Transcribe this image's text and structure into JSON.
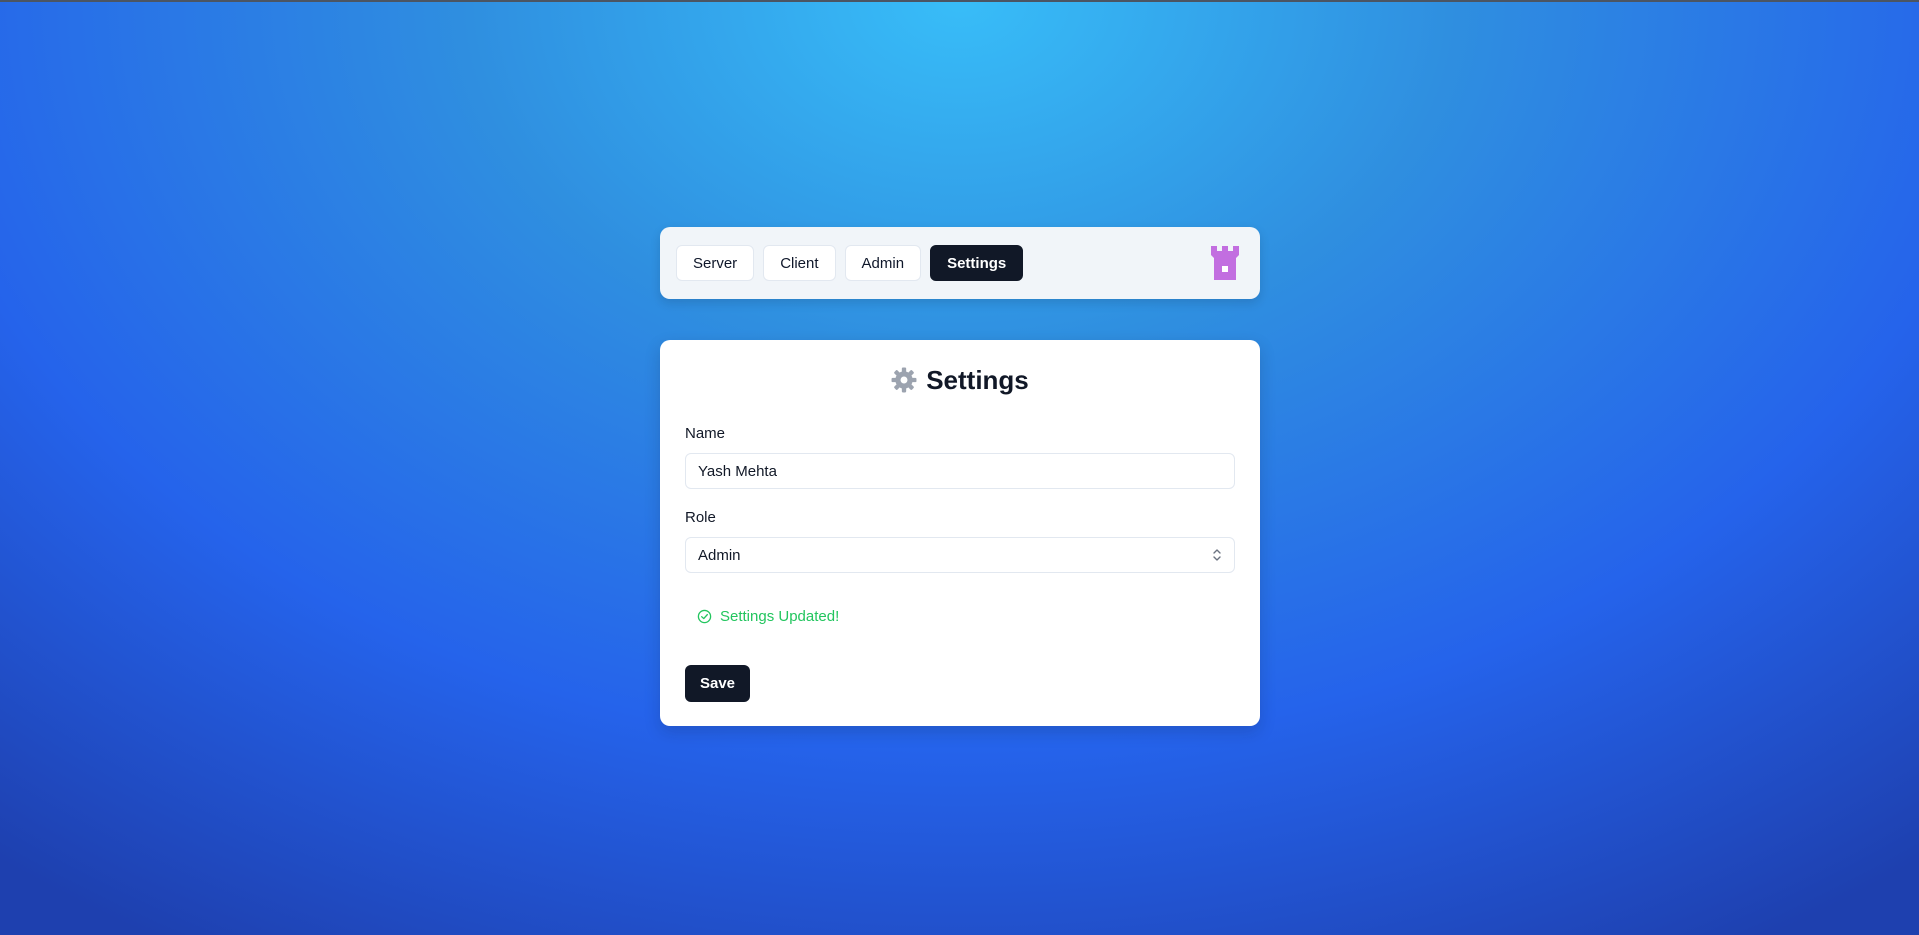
{
  "nav": {
    "tabs": [
      {
        "label": "Server",
        "active": false
      },
      {
        "label": "Client",
        "active": false
      },
      {
        "label": "Admin",
        "active": false
      },
      {
        "label": "Settings",
        "active": true
      }
    ],
    "logo_icon": "castle-icon",
    "logo_color": "#c26ee0"
  },
  "settings": {
    "title": "Settings",
    "title_icon": "gear-icon",
    "name_label": "Name",
    "name_value": "Yash Mehta",
    "role_label": "Role",
    "role_value": "Admin",
    "status_message": "Settings Updated!",
    "status_icon": "check-circle-icon",
    "save_label": "Save"
  },
  "colors": {
    "accent_dark": "#111827",
    "success": "#22c55e",
    "gear": "#9ca3af"
  }
}
